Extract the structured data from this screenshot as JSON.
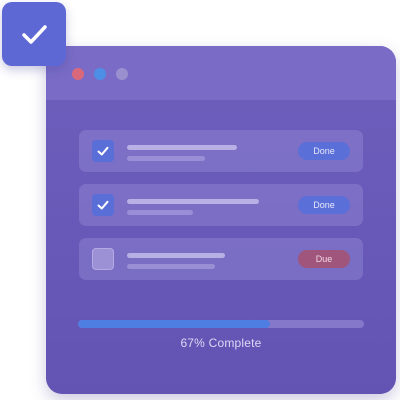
{
  "colors": {
    "window_bg": "#6a5bba",
    "titlebar_bg": "#7a6cc6",
    "dot_red": "#d9687a",
    "dot_blue": "#4d8fe6",
    "dot_gray": "#9a90cf",
    "accent": "#5a6ed8",
    "done_badge": "#5a70d8",
    "due_badge": "#a0557d",
    "progress_fill": "#4f7ee3"
  },
  "floating_badge": {
    "icon": "check-icon"
  },
  "window": {
    "dots": [
      "red",
      "blue",
      "gray"
    ]
  },
  "tasks": [
    {
      "checked": true,
      "status": "Done",
      "status_type": "done"
    },
    {
      "checked": true,
      "status": "Done",
      "status_type": "done"
    },
    {
      "checked": false,
      "status": "Due",
      "status_type": "due"
    }
  ],
  "progress": {
    "fraction": 0.67,
    "label": "67% Complete"
  }
}
